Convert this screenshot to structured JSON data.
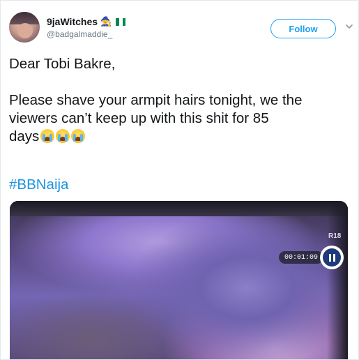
{
  "user": {
    "display_name": "9jaWitches",
    "handle": "@badgalmaddie_",
    "name_emoji": "🧙",
    "flag_colors": [
      "#008751",
      "#ffffff",
      "#008751"
    ]
  },
  "header": {
    "follow_label": "Follow",
    "accent_color": "#1da1f2"
  },
  "tweet": {
    "lines": [
      "Dear Tobi Bakre,",
      "Please shave your armpit hairs tonight, we the",
      "viewers can’t keep up with this shit for 85",
      "days"
    ],
    "emoji_count": 3,
    "emoji_name": "loudly-crying-face",
    "hashtag": "#BBNaija"
  },
  "media": {
    "rating_badge": "R18",
    "timestamp": "00:01:09"
  }
}
